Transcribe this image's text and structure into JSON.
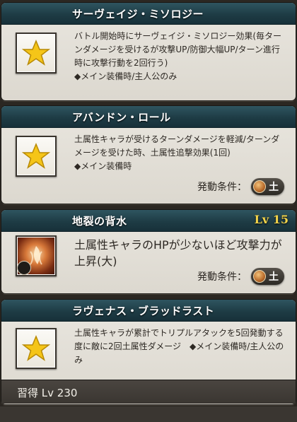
{
  "cards": [
    {
      "title": "サーヴェイジ・ミソロジー",
      "desc": "バトル開始時にサーヴェイジ・ミソロジー効果(毎ターンダメージを受けるが攻撃UP/防御大幅UP/ターン進行時に攻撃行動を2回行う)\n◆メイン装備時/主人公のみ",
      "icon": "star-icon"
    },
    {
      "title": "アバンドン・ロール",
      "desc": "土属性キャラが受けるターンダメージを軽減/ターンダメージを受けた時、土属性追撃効果(1回)\n◆メイン装備時",
      "cond_label": "発動条件：",
      "cond_value": "土",
      "icon": "star-icon"
    },
    {
      "title": "地裂の背水",
      "level": "Lv 15",
      "desc": "土属性キャラのHPが少ないほど攻撃力が上昇(大)",
      "cond_label": "発動条件：",
      "cond_value": "土",
      "icon": "earth-orb-icon"
    },
    {
      "title": "ラヴェナス・ブラッドラスト",
      "desc": "土属性キャラが累計でトリプルアタックを5回発動する度に敵に2回土属性ダメージ　◆メイン装備時/主人公のみ",
      "icon": "star-icon",
      "footer": "習得 Lv 230"
    }
  ],
  "colors": {
    "header_teal": "#1e3c45",
    "level_gold": "#f5d54a",
    "star_gold": "#f5c518"
  }
}
